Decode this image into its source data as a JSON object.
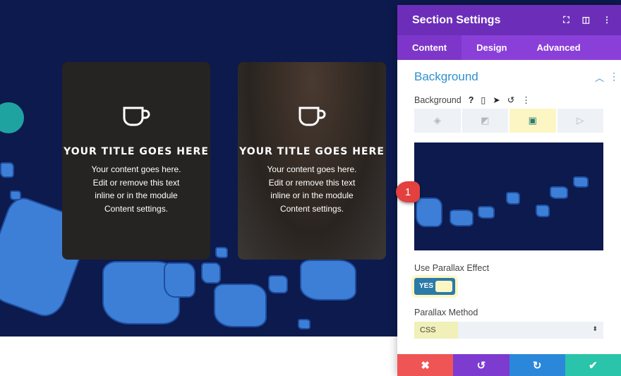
{
  "canvas": {
    "cards": [
      {
        "title": "YOUR TITLE GOES HERE",
        "body": "Your content goes here. Edit or remove this text inline or in the module Content settings.",
        "icon": "coffee-cup-icon"
      },
      {
        "title": "YOUR TITLE GOES HERE",
        "body": "Your content goes here. Edit or remove this text inline or in the module Content settings.",
        "icon": "coffee-cup-icon"
      }
    ]
  },
  "panel": {
    "title": "Section Settings",
    "tabs": [
      "Content",
      "Design",
      "Advanced"
    ],
    "section_title": "Background",
    "background_label": "Background",
    "marker": "1",
    "parallax_label": "Use Parallax Effect",
    "parallax_value": "YES",
    "method_label": "Parallax Method",
    "method_value": "CSS"
  },
  "colors": {
    "header": "#6c2eb9",
    "tabs": "#8b3fd9",
    "accent": "#2e8fd0",
    "cancel": "#ef5555",
    "undo": "#7d3bd0",
    "redo": "#2b87da",
    "save": "#29c4a9"
  }
}
